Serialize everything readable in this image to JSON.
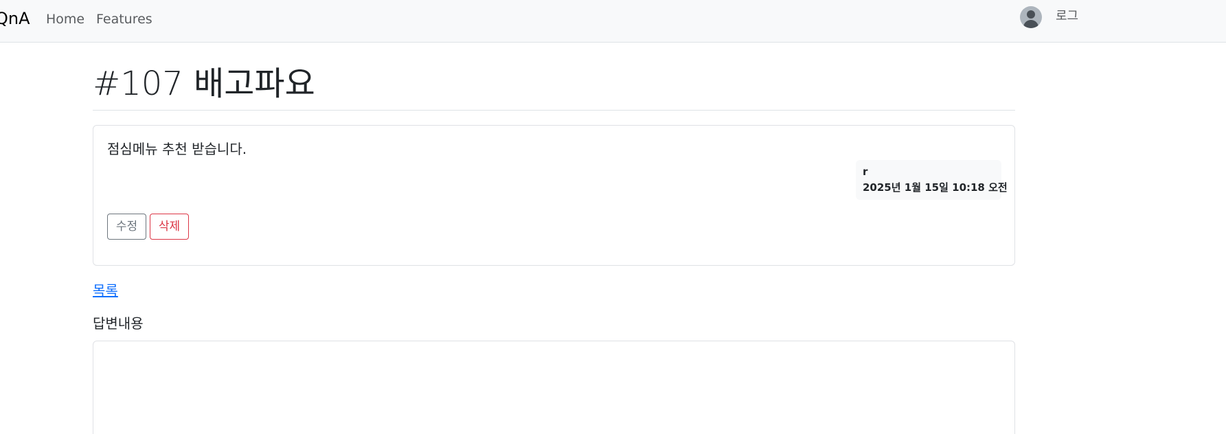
{
  "navbar": {
    "brand": "QnA",
    "links": [
      {
        "label": "Home"
      },
      {
        "label": "Features"
      }
    ],
    "login_label": "로그"
  },
  "question": {
    "title": "#107 배고파요",
    "content": "점심메뉴 추천 받습니다.",
    "author": "r",
    "created_at": "2025년 1월 15일 10:18 오전",
    "edit_label": "수정",
    "delete_label": "삭제"
  },
  "list_link": "목록",
  "answer": {
    "label": "답변내용",
    "value": ""
  }
}
